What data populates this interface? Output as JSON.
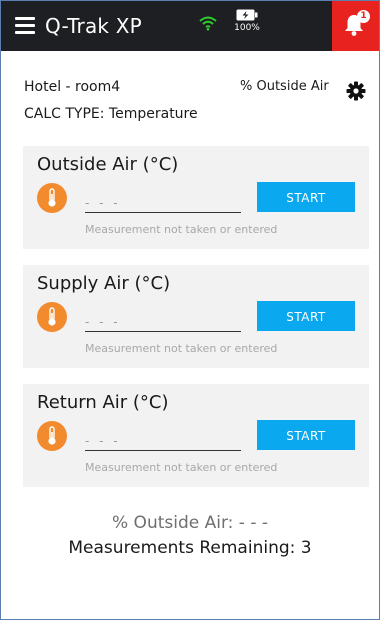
{
  "header": {
    "app_title": "Q-Trak XP",
    "battery_percent": "100%",
    "alert_count": "1",
    "wifi_icon": "wifi-icon",
    "battery_icon": "battery-charging-icon",
    "bell_icon": "bell-icon",
    "menu_icon": "menu-icon",
    "bar_color": "#1d1f22",
    "alert_color": "#e8231f",
    "wifi_color": "#2ecc2e"
  },
  "info": {
    "location": "Hotel - room4",
    "calc_type": "CALC TYPE: Temperature",
    "mode": "% Outside Air",
    "settings_icon": "gear-icon"
  },
  "cards": [
    {
      "title": "Outside Air (°C)",
      "value": "- - -",
      "button": "START",
      "status": "Measurement not taken or entered"
    },
    {
      "title": "Supply Air (°C)",
      "value": "- - -",
      "button": "START",
      "status": "Measurement not taken or entered"
    },
    {
      "title": "Return Air (°C)",
      "value": "- - -",
      "button": "START",
      "status": "Measurement not taken or entered"
    }
  ],
  "results": {
    "outside_air_pct": "% Outside Air: - - -",
    "remaining": "Measurements Remaining: 3"
  },
  "colors": {
    "accent": "#0aa8ee",
    "thermometer_badge": "#f28a2e",
    "card_background": "#f2f2f2"
  }
}
